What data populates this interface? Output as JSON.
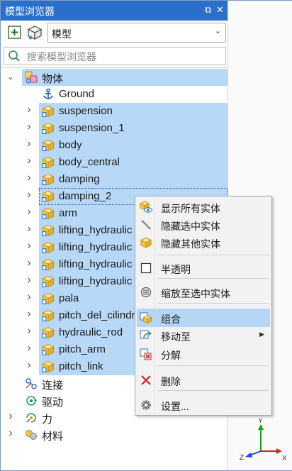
{
  "window": {
    "title": "模型浏览器",
    "restore_glyph": "⧉",
    "close_glyph": "✕"
  },
  "toolbar": {
    "filter_value": "模型",
    "filter_options": [
      "模型"
    ]
  },
  "search": {
    "placeholder": "搜索模型浏览器"
  },
  "tree": {
    "root": {
      "label": "物体",
      "expanded": true,
      "icon": "parts-icon"
    },
    "ground": {
      "label": "Ground",
      "icon": "anchor-icon"
    },
    "bodies": [
      {
        "label": "suspension",
        "selected": true
      },
      {
        "label": "suspension_1",
        "selected": true
      },
      {
        "label": "body",
        "selected": true
      },
      {
        "label": "body_central",
        "selected": true
      },
      {
        "label": "damping",
        "selected": true
      },
      {
        "label": "damping_2",
        "selected": true,
        "focused": true
      },
      {
        "label": "arm",
        "selected": true
      },
      {
        "label": "lifting_hydraulic",
        "selected": true
      },
      {
        "label": "lifting_hydraulic",
        "selected": true
      },
      {
        "label": "lifting_hydraulic",
        "selected": true
      },
      {
        "label": "lifting_hydraulic",
        "selected": true
      },
      {
        "label": "pala",
        "selected": true
      },
      {
        "label": "pitch_del_cilindro",
        "selected": true
      },
      {
        "label": "hydraulic_rod",
        "selected": true
      },
      {
        "label": "pitch_arm",
        "selected": true
      },
      {
        "label": "pitch_link",
        "selected": true
      }
    ],
    "groups": [
      {
        "label": "连接",
        "icon": "joint-icon"
      },
      {
        "label": "驱动",
        "icon": "drive-icon"
      },
      {
        "label": "力",
        "icon": "force-icon"
      },
      {
        "label": "材料",
        "icon": "material-icon"
      }
    ]
  },
  "context_menu": {
    "items": [
      {
        "label": "显示所有实体",
        "icon": "show-all-icon"
      },
      {
        "label": "隐藏选中实体",
        "icon": "hide-selected-icon"
      },
      {
        "label": "隐藏其他实体",
        "icon": "hide-others-icon"
      },
      {
        "label": "半透明",
        "icon": "checkbox-icon"
      },
      {
        "label": "缩放至选中实体",
        "icon": "zoom-fit-icon"
      },
      {
        "label": "组合",
        "icon": "group-icon",
        "highlighted": true
      },
      {
        "label": "移动至",
        "icon": "move-to-icon",
        "submenu": true
      },
      {
        "label": "分解",
        "icon": "ungroup-icon"
      },
      {
        "label": "删除",
        "icon": "delete-icon"
      },
      {
        "label": "设置...",
        "icon": "settings-icon"
      }
    ]
  },
  "triad": {
    "x": "X",
    "y": "Y",
    "z": "Z"
  },
  "colors": {
    "title_bar": "#2a6fc9",
    "selection": "#b8d8f8",
    "menu_highlight": "#b5d6f5",
    "axis_x": "#e02020",
    "axis_y": "#20a020",
    "axis_z": "#2040e0"
  }
}
